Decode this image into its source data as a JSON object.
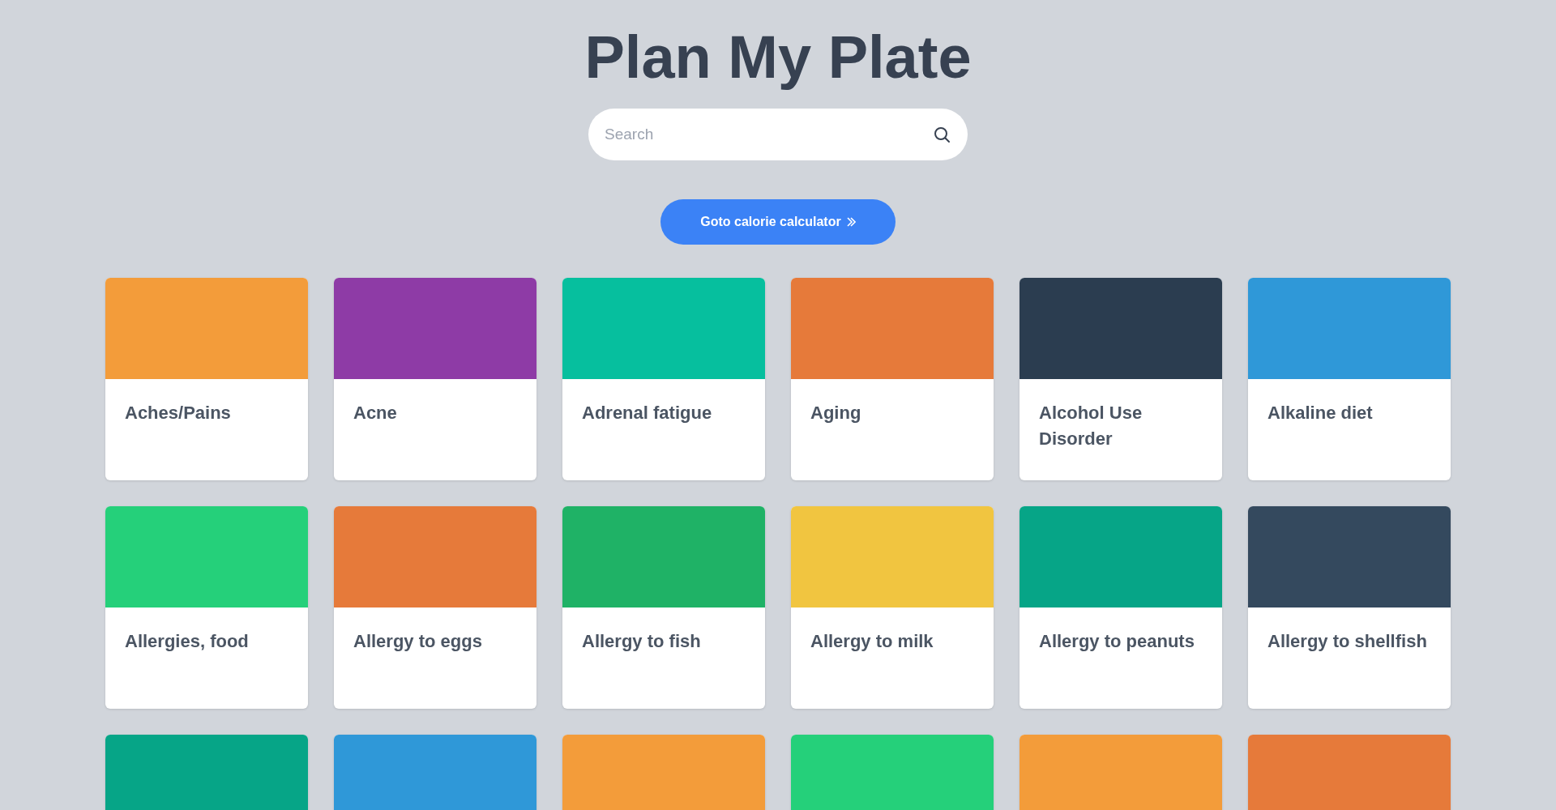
{
  "title": "Plan My Plate",
  "search": {
    "placeholder": "Search"
  },
  "calculator_button": {
    "label": "Goto calorie calculator"
  },
  "cards": [
    {
      "label": "Aches/Pains",
      "color": "#f39c3a"
    },
    {
      "label": "Acne",
      "color": "#8e3ba6"
    },
    {
      "label": "Adrenal fatigue",
      "color": "#06bf9e"
    },
    {
      "label": "Aging",
      "color": "#e67a3a"
    },
    {
      "label": "Alcohol Use Disorder",
      "color": "#2b3d50"
    },
    {
      "label": "Alkaline diet",
      "color": "#2f98d8"
    },
    {
      "label": "Allergies, food",
      "color": "#25d07a"
    },
    {
      "label": "Allergy to eggs",
      "color": "#e67a3a"
    },
    {
      "label": "Allergy to fish",
      "color": "#1fb266"
    },
    {
      "label": "Allergy to milk",
      "color": "#f1c540"
    },
    {
      "label": "Allergy to peanuts",
      "color": "#06a587"
    },
    {
      "label": "Allergy to shellfish",
      "color": "#34495e"
    },
    {
      "color": "#06a587"
    },
    {
      "color": "#2f98d8"
    },
    {
      "color": "#f39c3a"
    },
    {
      "color": "#25d07a"
    },
    {
      "color": "#f39c3a"
    },
    {
      "color": "#e67a3a"
    }
  ]
}
